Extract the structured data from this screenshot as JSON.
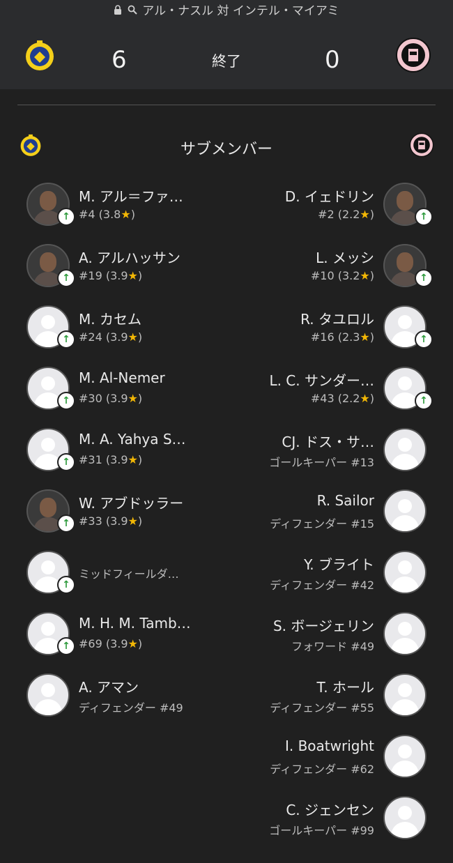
{
  "header": {
    "url_text": "アル・ナスル 対 インテル・マイアミ",
    "home_score": "6",
    "away_score": "0",
    "status": "終了"
  },
  "section": {
    "title": "サブメンバー"
  },
  "colors": {
    "background": "#202020",
    "header": "#2b2c2e",
    "star": "#f2b705",
    "arrow": "#2e9a3c"
  },
  "home_subs": [
    {
      "name": "M. アル＝ファ…",
      "info": "#4 (3.8",
      "star": "★",
      "close": ")",
      "photo": true,
      "subbed_on": true
    },
    {
      "name": "A. アルハッサン",
      "info": "#19 (3.9",
      "star": "★",
      "close": ")",
      "photo": true,
      "subbed_on": true
    },
    {
      "name": "M. カセム",
      "info": "#24 (3.9",
      "star": "★",
      "close": ")",
      "photo": false,
      "subbed_on": true
    },
    {
      "name": "M. Al-Nemer",
      "info": "#30 (3.9",
      "star": "★",
      "close": ")",
      "photo": false,
      "subbed_on": true
    },
    {
      "name": "M. A. Yahya S…",
      "info": "#31 (3.9",
      "star": "★",
      "close": ")",
      "photo": false,
      "subbed_on": true
    },
    {
      "name": "W. アブドッラー",
      "info": "#33 (3.9",
      "star": "★",
      "close": ")",
      "photo": true,
      "subbed_on": true
    },
    {
      "name": "",
      "info": "ミッドフィールダ…",
      "star": "",
      "close": "",
      "photo": false,
      "subbed_on": true
    },
    {
      "name": "M. H. M. Tamb…",
      "info": "#69 (3.9",
      "star": "★",
      "close": ")",
      "photo": false,
      "subbed_on": true
    },
    {
      "name": "A. アマン",
      "info": "ディフェンダー #49",
      "star": "",
      "close": "",
      "photo": false,
      "subbed_on": false
    }
  ],
  "away_subs": [
    {
      "name": "D. イェドリン",
      "info": "#2 (2.2",
      "star": "★",
      "close": ")",
      "photo": true,
      "subbed_on": true
    },
    {
      "name": "L. メッシ",
      "info": "#10 (3.2",
      "star": "★",
      "close": ")",
      "photo": true,
      "subbed_on": true
    },
    {
      "name": "R. タユロル",
      "info": "#16 (2.3",
      "star": "★",
      "close": ")",
      "photo": false,
      "subbed_on": true
    },
    {
      "name": "L. C. サンダー…",
      "info": "#43 (2.2",
      "star": "★",
      "close": ")",
      "photo": false,
      "subbed_on": true
    },
    {
      "name": "CJ. ドス・サ…",
      "info": "ゴールキーパー #13",
      "star": "",
      "close": "",
      "photo": false,
      "subbed_on": false
    },
    {
      "name": "R. Sailor",
      "info": "ディフェンダー #15",
      "star": "",
      "close": "",
      "photo": false,
      "subbed_on": false
    },
    {
      "name": "Y. ブライト",
      "info": "ディフェンダー #42",
      "star": "",
      "close": "",
      "photo": false,
      "subbed_on": false
    },
    {
      "name": "S. ボージェリン",
      "info": "フォワード #49",
      "star": "",
      "close": "",
      "photo": false,
      "subbed_on": false
    },
    {
      "name": "T. ホール",
      "info": "ディフェンダー #55",
      "star": "",
      "close": "",
      "photo": false,
      "subbed_on": false
    },
    {
      "name": "I. Boatwright",
      "info": "ディフェンダー #62",
      "star": "",
      "close": "",
      "photo": false,
      "subbed_on": false
    },
    {
      "name": "C. ジェンセン",
      "info": "ゴールキーパー #99",
      "star": "",
      "close": "",
      "photo": false,
      "subbed_on": false
    }
  ]
}
